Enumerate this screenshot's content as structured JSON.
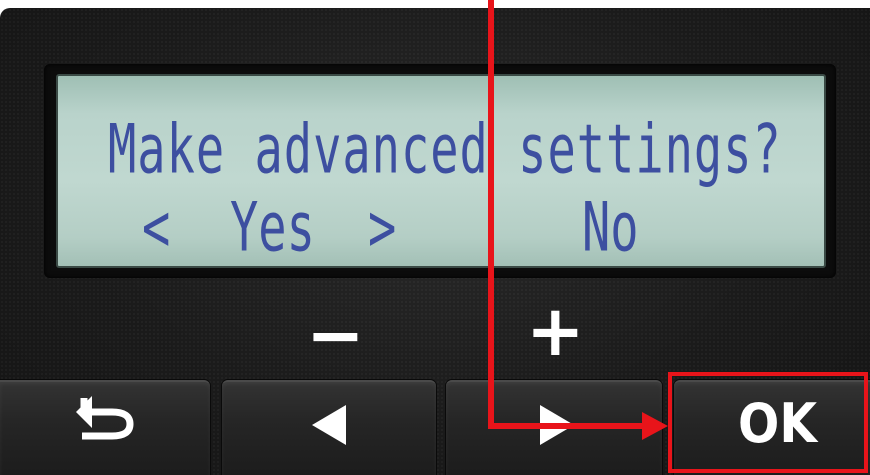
{
  "lcd": {
    "prompt": "Make advanced settings?",
    "left_arrow": "<",
    "yes_option": "Yes",
    "right_arrow": ">",
    "no_option": "No"
  },
  "labels": {
    "minus": "−",
    "plus": "+"
  },
  "buttons": {
    "back_icon": "back-arrow-icon",
    "left_icon": "left-triangle-icon",
    "right_icon": "right-triangle-icon",
    "ok_label": "OK"
  },
  "colors": {
    "lcd_text": "#3d4fa0",
    "lcd_background": "#c0d8d0",
    "annotation": "#e8141a",
    "panel": "#1b1b1b"
  }
}
